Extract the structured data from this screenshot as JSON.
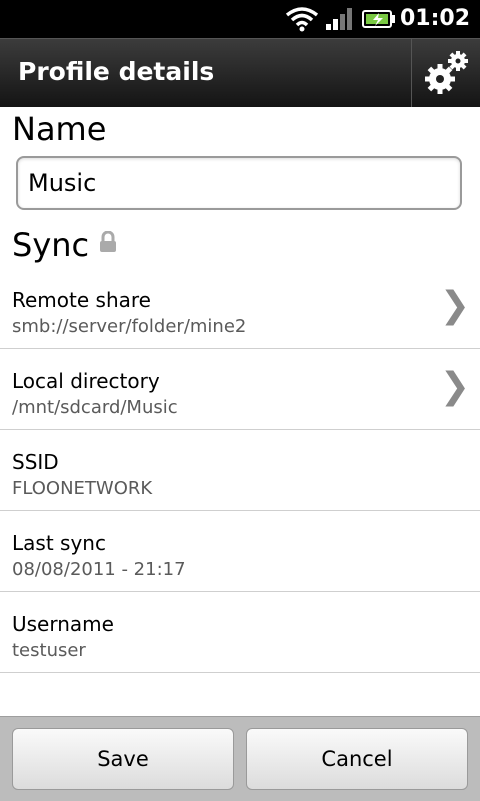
{
  "status_bar": {
    "time": "01:02"
  },
  "title_bar": {
    "title": "Profile details",
    "settings_icon": "gears-icon"
  },
  "name_section": {
    "header": "Name",
    "value": "Music"
  },
  "sync_section": {
    "header": "Sync",
    "rows": [
      {
        "label": "Remote share",
        "value": "smb://server/folder/mine2",
        "chevron": "❯"
      },
      {
        "label": "Local directory",
        "value": "/mnt/sdcard/Music",
        "chevron": "❯"
      },
      {
        "label": "SSID",
        "value": "FLOONETWORK"
      },
      {
        "label": "Last sync",
        "value": "08/08/2011 - 21:17"
      },
      {
        "label": "Username",
        "value": "testuser"
      }
    ]
  },
  "buttons": {
    "save": "Save",
    "cancel": "Cancel"
  }
}
